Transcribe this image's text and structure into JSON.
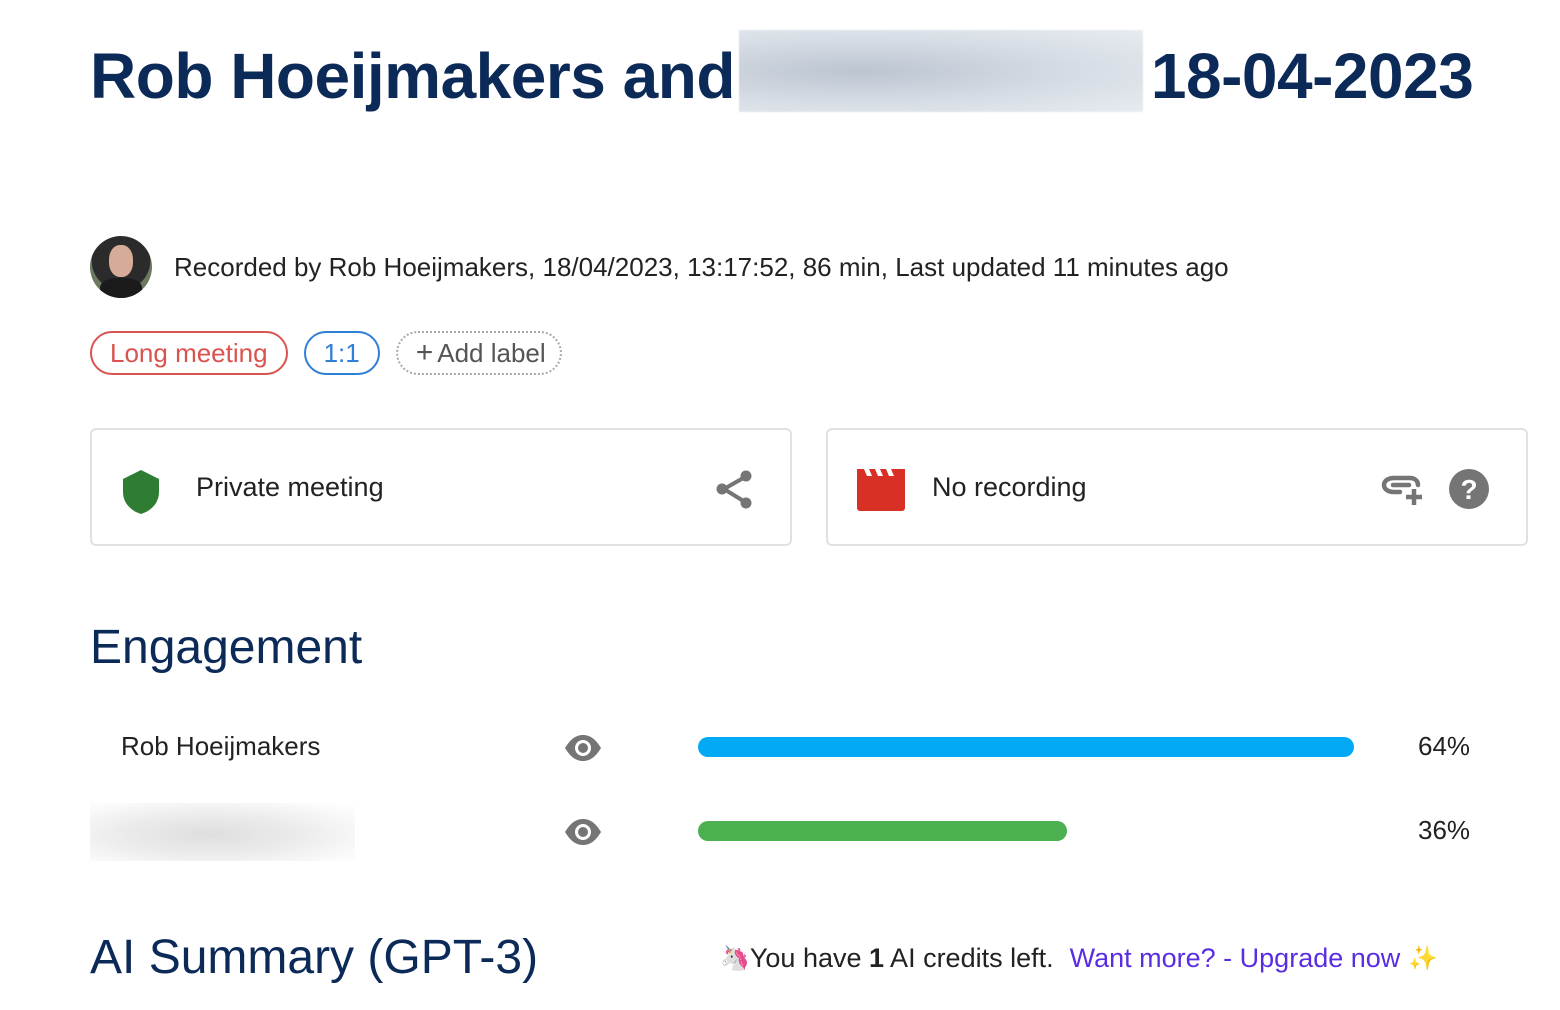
{
  "header": {
    "title_part1": "Rob Hoeijmakers and",
    "title_part2": "18-04-2023",
    "title_redacted_name": ""
  },
  "meta": {
    "recorded_text": "Recorded by Rob Hoeijmakers, 18/04/2023, 13:17:52, 86 min, Last updated 11 minutes ago"
  },
  "labels": [
    {
      "text": "Long meeting",
      "color": "#d9534f"
    },
    {
      "text": "1:1",
      "color": "#2f7fd4"
    }
  ],
  "add_label": {
    "plus": "+",
    "text": "Add label"
  },
  "cards": {
    "privacy": {
      "text": "Private meeting",
      "icon": "shield-icon",
      "action_icon": "share-icon",
      "icon_color": "#2e7d32"
    },
    "recording": {
      "text": "No recording",
      "icon": "clapperboard-icon",
      "action_icons": [
        "add-link-icon",
        "help-icon"
      ],
      "icon_color": "#d93025"
    }
  },
  "engagement": {
    "heading": "Engagement",
    "participants": [
      {
        "name": "Rob Hoeijmakers",
        "percent": 64,
        "percent_label": "64%",
        "color": "#03a9f4",
        "redacted": false
      },
      {
        "name": "",
        "percent": 36,
        "percent_label": "36%",
        "color": "#4caf50",
        "redacted": true
      }
    ]
  },
  "ai_summary": {
    "heading": "AI Summary (GPT-3)",
    "unicorn": "🦄",
    "credits_prefix": "You have ",
    "credits_count": "1",
    "credits_suffix": " AI credits left.",
    "upgrade_link": "Want more? - Upgrade now",
    "sparkles": "✨",
    "link_color": "#5a2de3"
  }
}
